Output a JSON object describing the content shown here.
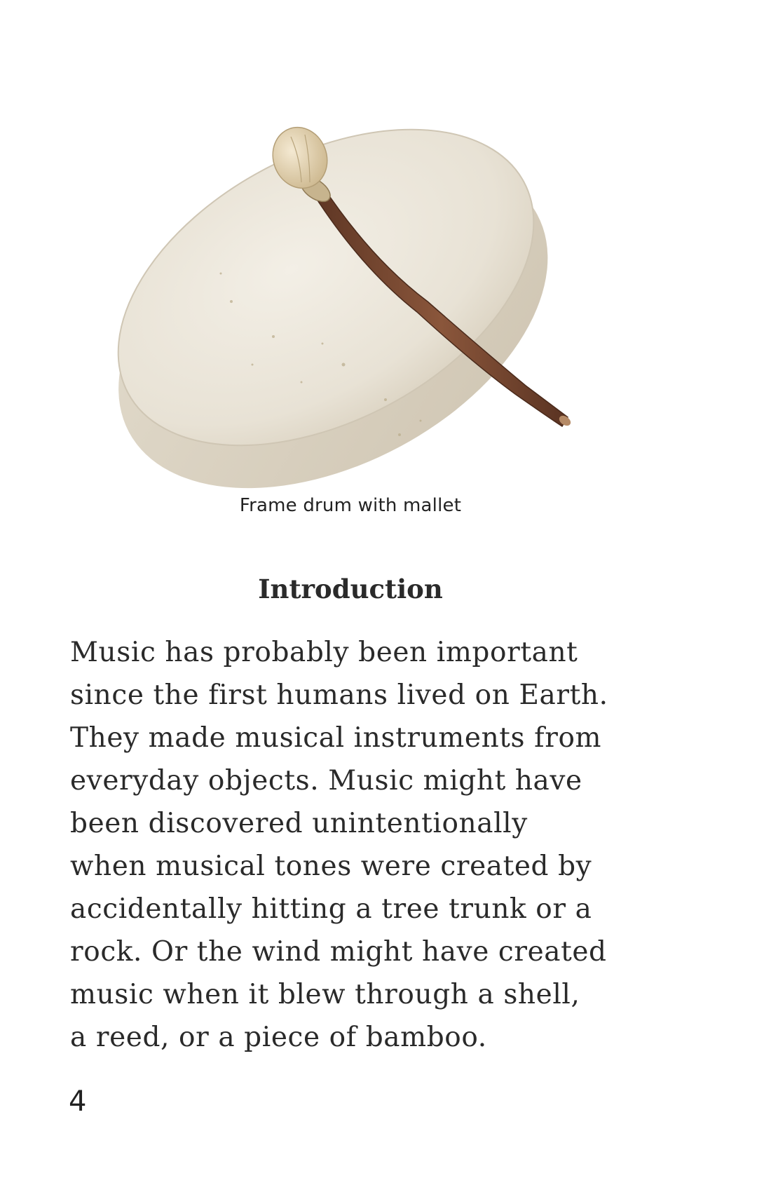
{
  "figure": {
    "caption": "Frame drum with mallet",
    "icon": "frame-drum-with-mallet-illustration",
    "colors": {
      "drum_face": "#e9e4d9",
      "drum_rim": "#d9d1c1",
      "mallet_head": "#e6d7b8",
      "mallet_stick": "#7a4a33"
    }
  },
  "section": {
    "heading": "Introduction",
    "lines": [
      "Music has probably been important",
      "since the first humans lived on Earth.",
      "They made musical instruments from",
      "everyday objects. Music might have",
      "been discovered unintentionally",
      "when musical tones were created by",
      "accidentally hitting a tree trunk or a",
      "rock. Or the wind might have created",
      "music when it blew through a shell,",
      "a reed, or a piece of bamboo."
    ]
  },
  "page": {
    "number": "4"
  }
}
